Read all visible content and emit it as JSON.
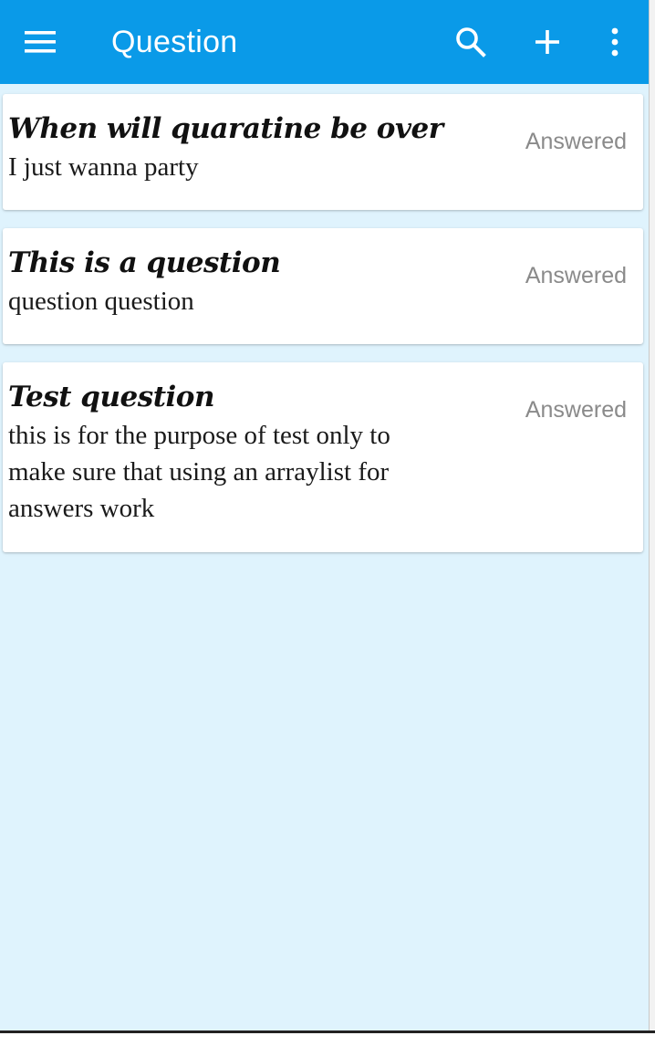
{
  "toolbar": {
    "title": "Question",
    "background_color": "#0a9ae8",
    "icons": [
      "menu-icon",
      "search-icon",
      "add-icon",
      "more-vert-icon"
    ]
  },
  "questions": [
    {
      "title": "When will quaratine be over",
      "body": "I just wanna party",
      "status": "Answered"
    },
    {
      "title": "This is a question",
      "body": "question question",
      "status": "Answered"
    },
    {
      "title": "Test question",
      "body": "this is for the purpose of test only to make sure that using an arraylist for answers work",
      "status": "Answered"
    }
  ],
  "colors": {
    "list_background": "#dff3fd",
    "status_text": "#8a8a8a"
  }
}
